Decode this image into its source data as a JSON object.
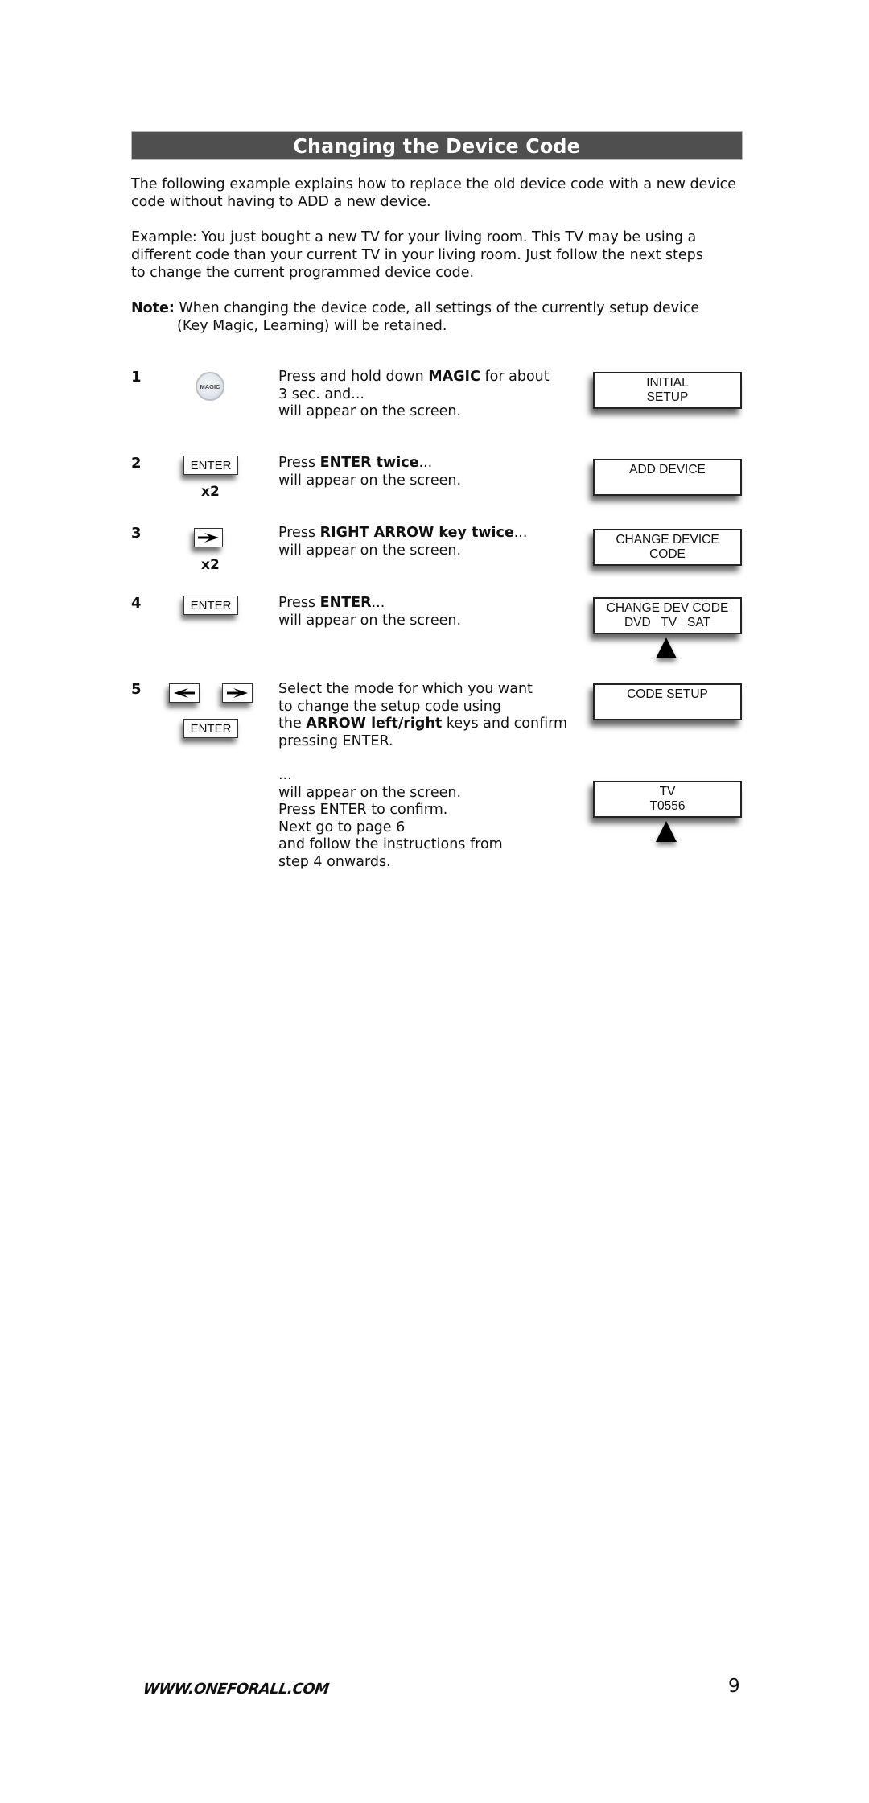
{
  "title": "Changing the Device Code",
  "intro": {
    "line1": "The following example explains how to replace the old device code with a new device",
    "line2": "code without having to ADD a new device."
  },
  "example": {
    "line1": "Example: You just bought a new TV for your living room. This TV may be using a",
    "line2": "different code than your current TV in your living room. Just follow the next steps",
    "line3": "to change the current programmed device code."
  },
  "note": {
    "label": "Note:",
    "line1": "When changing the device code, all settings of the currently setup device",
    "line2": "(Key Magic, Learning) will be retained."
  },
  "steps": [
    {
      "number": "1",
      "key_label": "MAGIC",
      "text": {
        "pre": "Press and hold down ",
        "bold": "MAGIC",
        "post": " for about",
        "line2": "3 sec. and...",
        "line3": "will appear on the screen."
      },
      "screen": {
        "line1": "INITIAL",
        "line2": "SETUP"
      }
    },
    {
      "number": "2",
      "key_label": "ENTER",
      "multiplier": "x2",
      "text": {
        "pre": "Press ",
        "bold": "ENTER twice",
        "post": "...",
        "line2": "will appear on the screen."
      },
      "screen": {
        "line1": "ADD DEVICE",
        "line2": ""
      }
    },
    {
      "number": "3",
      "key_icon": "right-arrow",
      "multiplier": "x2",
      "text": {
        "pre": "Press ",
        "bold": "RIGHT ARROW key twice",
        "post": "...",
        "line2": "will appear on the screen."
      },
      "screen": {
        "line1": "CHANGE DEVICE",
        "line2": "CODE"
      }
    },
    {
      "number": "4",
      "key_label": "ENTER",
      "text": {
        "pre": "Press ",
        "bold": "ENTER",
        "post": "...",
        "line2": "will appear on the screen."
      },
      "screen": {
        "line1": "CHANGE DEV CODE",
        "line2": "DVD   TV   SAT"
      }
    },
    {
      "number": "5",
      "key_icons": [
        "left-arrow",
        "right-arrow"
      ],
      "key_label": "ENTER",
      "text": {
        "line1": "Select the mode for which you want",
        "line2": "to change the setup code using",
        "pre3": "the ",
        "bold3": "ARROW left/right",
        "post3": " keys and confirm",
        "line4": "pressing ENTER."
      },
      "screen": {
        "line1": "CODE SETUP",
        "line2": ""
      },
      "followup": {
        "line1": "...",
        "line2": "will appear on the screen.",
        "line3": "Press ENTER to confirm.",
        "line4": "Next go to page 6",
        "line5": "and follow the instructions from",
        "line6": "step 4 onwards."
      },
      "followup_screen": {
        "line1": "TV",
        "line2": "T0556"
      }
    }
  ],
  "footer": {
    "url": "WWW.ONEFORALL.COM",
    "page_number": "9"
  }
}
